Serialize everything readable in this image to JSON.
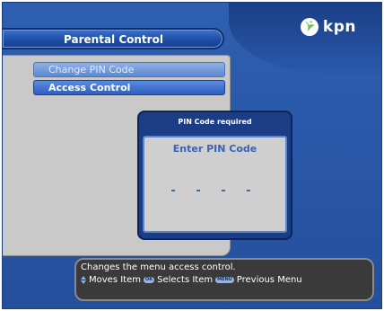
{
  "brand": {
    "logo_text": "kpn"
  },
  "title": "Parental Control",
  "menu": {
    "items": [
      {
        "label": "Change PIN Code",
        "selected": false
      },
      {
        "label": "Access Control",
        "selected": true
      }
    ]
  },
  "pin_dialog": {
    "header": "PIN Code required",
    "prompt": "Enter PIN Code",
    "placeholder": "- - - -"
  },
  "help": {
    "description": "Changes the menu access control.",
    "moves_label": "Moves Item",
    "ok_key": "OK",
    "selects_label": "Selects Item",
    "menu_key": "MENU",
    "previous_label": "Previous Menu"
  },
  "colors": {
    "background": "#2a58a8",
    "panel": "#c9c9c9",
    "selected_item": "#2d5fc0",
    "dialog": "#1a3d86",
    "help_bar": "#3a3a3a",
    "logo_green": "#6cc04a"
  },
  "icons": [
    "kpn-logo-icon",
    "up-down-arrows-icon",
    "ok-key-icon",
    "menu-key-icon"
  ]
}
